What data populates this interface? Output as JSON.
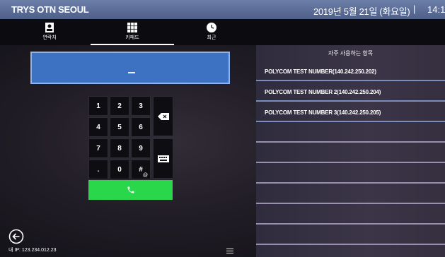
{
  "topbar": {
    "title": "TRYS OTN SEOUL",
    "date": "2019년 5월 21일 (화요일)",
    "separator": "|",
    "time": "14:1("
  },
  "tabs": [
    {
      "label": "연락처",
      "icon": "contact-card-icon",
      "active": false
    },
    {
      "label": "키패드",
      "icon": "keypad-grid-icon",
      "active": true
    },
    {
      "label": "최근",
      "icon": "clock-icon",
      "active": false
    }
  ],
  "dial": {
    "value": "",
    "cursor": "_"
  },
  "keypad": {
    "keys": [
      "1",
      "2",
      "3",
      "4",
      "5",
      "6",
      "7",
      "8",
      "9",
      ".",
      "0",
      "#"
    ],
    "hash_sub": "@",
    "backspace_icon": "backspace-icon",
    "keyboard_icon": "keyboard-icon",
    "call_icon": "phone-icon",
    "call_color": "#2ad64a"
  },
  "favorites": {
    "header": "자주 사용하는 항목",
    "items": [
      "POLYCOM TEST NUMBER(140.242.250.202)",
      "POLYCOM TEST NUMBER 2(140.242.250.204)",
      "POLYCOM TEST NUMBER 3(140.242.250.205)"
    ]
  },
  "footer": {
    "ip": "내 IP: 123.234.012.23",
    "back_icon": "back-arrow-icon",
    "menu_icon": "menu-handle-icon"
  },
  "colors": {
    "topbar": "#5a6b96",
    "dial_field": "#3d72c2",
    "favorites_divider": "#7b8dbd"
  }
}
